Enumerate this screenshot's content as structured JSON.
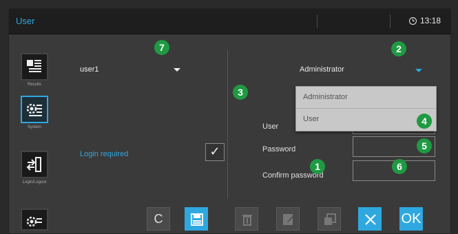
{
  "header": {
    "title": "User",
    "time": "13:18"
  },
  "sidebar": {
    "items": [
      {
        "label": "Results",
        "icon": "results-icon",
        "active": false
      },
      {
        "label": "System",
        "icon": "system-icon",
        "active": true
      },
      {
        "label": "Login/Logout",
        "icon": "login-logout-icon",
        "active": false
      },
      {
        "label": "",
        "icon": "settings-icon",
        "active": false
      }
    ]
  },
  "user_panel": {
    "selected_user": "user1",
    "login_required_label": "Login required",
    "login_required_checked": true
  },
  "details_panel": {
    "role": "Administrator",
    "role_options": [
      "Administrator",
      "User"
    ],
    "fields": {
      "user_label": "User",
      "password_label": "Password",
      "confirm_password_label": "Confirm password"
    }
  },
  "badges": [
    "7",
    "2",
    "3",
    "4",
    "5",
    "1",
    "6"
  ],
  "toolbar": {
    "cancel_label": "C",
    "ok_label": "OK"
  },
  "colors": {
    "accent": "#2fa8e0",
    "badge": "#1f9a43"
  }
}
